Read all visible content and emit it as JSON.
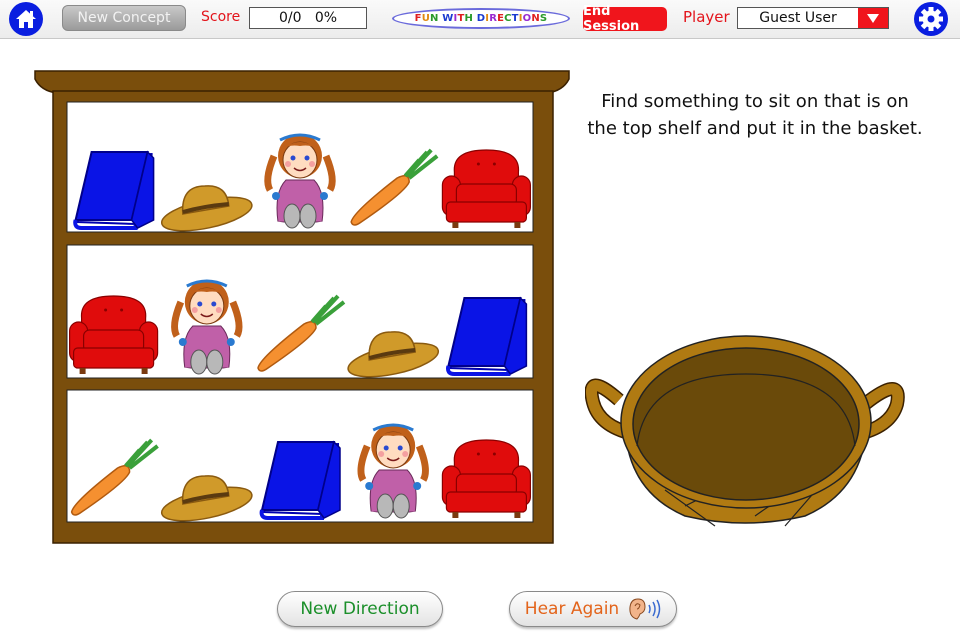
{
  "topbar": {
    "home_icon": "home-icon",
    "new_concept_label": "New Concept",
    "score_label": "Score",
    "score_value": "0/0   0%",
    "app_title_letters": [
      {
        "ch": "F",
        "color": "#e02020"
      },
      {
        "ch": "U",
        "color": "#e08a10"
      },
      {
        "ch": "N",
        "color": "#2a9a2a"
      },
      {
        "ch": " ",
        "color": "#000"
      },
      {
        "ch": "W",
        "color": "#1a3ad0"
      },
      {
        "ch": "I",
        "color": "#9a2ad0"
      },
      {
        "ch": "T",
        "color": "#e02020"
      },
      {
        "ch": "H",
        "color": "#2a9a2a"
      },
      {
        "ch": " ",
        "color": "#000"
      },
      {
        "ch": "D",
        "color": "#1a3ad0"
      },
      {
        "ch": "I",
        "color": "#e08a10"
      },
      {
        "ch": "R",
        "color": "#9a2ad0"
      },
      {
        "ch": "E",
        "color": "#e02020"
      },
      {
        "ch": "C",
        "color": "#2a9a2a"
      },
      {
        "ch": "T",
        "color": "#1a3ad0"
      },
      {
        "ch": "I",
        "color": "#e08a10"
      },
      {
        "ch": "O",
        "color": "#9a2ad0"
      },
      {
        "ch": "N",
        "color": "#e02020"
      },
      {
        "ch": "S",
        "color": "#2a9a2a"
      }
    ],
    "end_session_label": "End Session",
    "player_label": "Player",
    "player_value": "Guest User",
    "settings_icon": "gear-icon"
  },
  "instruction": "Find something to sit on that is on the top shelf and put it in the basket.",
  "shelves": [
    {
      "name": "top",
      "items": [
        "book",
        "hat",
        "doll",
        "carrot",
        "armchair"
      ]
    },
    {
      "name": "middle",
      "items": [
        "armchair",
        "doll",
        "carrot",
        "hat",
        "book"
      ]
    },
    {
      "name": "bottom",
      "items": [
        "carrot",
        "hat",
        "book",
        "doll",
        "armchair"
      ]
    }
  ],
  "basket": {
    "label": "basket",
    "contents": []
  },
  "buttons": {
    "new_direction_label": "New Direction",
    "hear_again_label": "Hear Again"
  },
  "colors": {
    "accent_blue": "#0a1ee0",
    "accent_red": "#f0151c",
    "shelf_wood": "#7a4e0c",
    "basket_tan": "#b07a12"
  }
}
